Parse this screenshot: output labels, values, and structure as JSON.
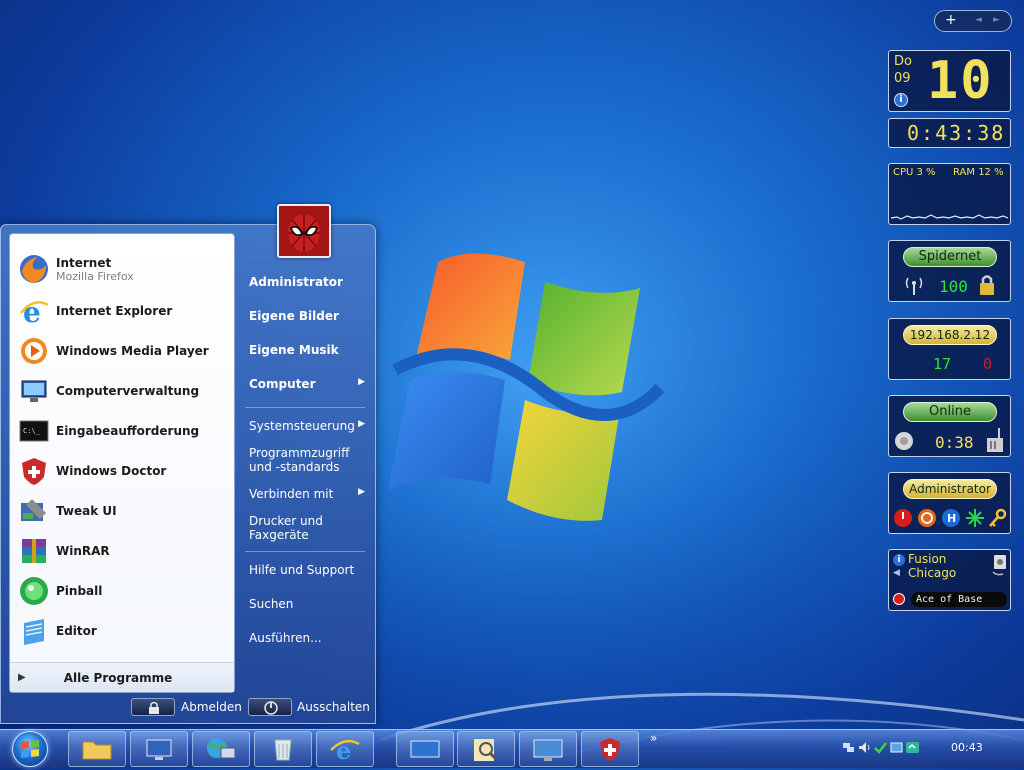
{
  "start_menu": {
    "pinned": [
      {
        "label": "Internet",
        "sub": "Mozilla Firefox",
        "icon": "firefox-icon"
      },
      {
        "label": "Internet Explorer",
        "icon": "internet-explorer-icon"
      },
      {
        "label": "Windows Media Player",
        "icon": "media-player-icon"
      },
      {
        "label": "Computerverwaltung",
        "icon": "computer-management-icon"
      },
      {
        "label": "Eingabeaufforderung",
        "icon": "command-prompt-icon"
      },
      {
        "label": "Windows Doctor",
        "icon": "windows-doctor-icon"
      },
      {
        "label": "Tweak UI",
        "icon": "tweak-ui-icon"
      },
      {
        "label": "WinRAR",
        "icon": "winrar-icon"
      },
      {
        "label": "Pinball",
        "icon": "pinball-icon"
      },
      {
        "label": "Editor",
        "icon": "editor-icon"
      }
    ],
    "all_programs": "Alle Programme",
    "right_items": [
      {
        "label": "Administrator"
      },
      {
        "label": "Eigene Bilder"
      },
      {
        "label": "Eigene Musik"
      },
      {
        "label": "Computer"
      },
      {
        "label": "Systemsteuerung"
      },
      {
        "label": "Programmzugriff"
      },
      {
        "label": "und -standards"
      },
      {
        "label": "Verbinden mit"
      },
      {
        "label": "Drucker und"
      },
      {
        "label": "Faxgeräte"
      },
      {
        "label": "Hilfe und Support"
      },
      {
        "label": "Suchen"
      },
      {
        "label": "Ausführen..."
      }
    ],
    "logoff_label": "Abmelden",
    "shutdown_label": "Ausschalten"
  },
  "gadgets": {
    "calendar": {
      "weekday": "Do",
      "month": "09",
      "day": "10"
    },
    "clock": {
      "time": "0:43:38"
    },
    "cpu": {
      "cpu_label": "CPU 3 %",
      "ram_label": "RAM 12 %",
      "cpu_percent": 3,
      "ram_percent": 12
    },
    "wifi": {
      "ssid": "Spidernet",
      "signal": "100"
    },
    "network": {
      "ip": "192.168.2.12",
      "sent": "17",
      "received": "0"
    },
    "connection": {
      "status": "Online",
      "duration": "0:38"
    },
    "user": {
      "name": "Administrator"
    },
    "media": {
      "line1": "Fusion",
      "line2": "Chicago",
      "track": "Ace of Base"
    }
  },
  "taskbar": {
    "clock": "00:43",
    "overflow": "»"
  },
  "colors": {
    "accent": "#1767c9",
    "pill_green": "#3e8f2f",
    "digit_green": "#2ee42e",
    "digit_yellow": "#f3e05d"
  },
  "side_bar": {
    "plus": "+",
    "prev": "◄",
    "next": "►"
  }
}
